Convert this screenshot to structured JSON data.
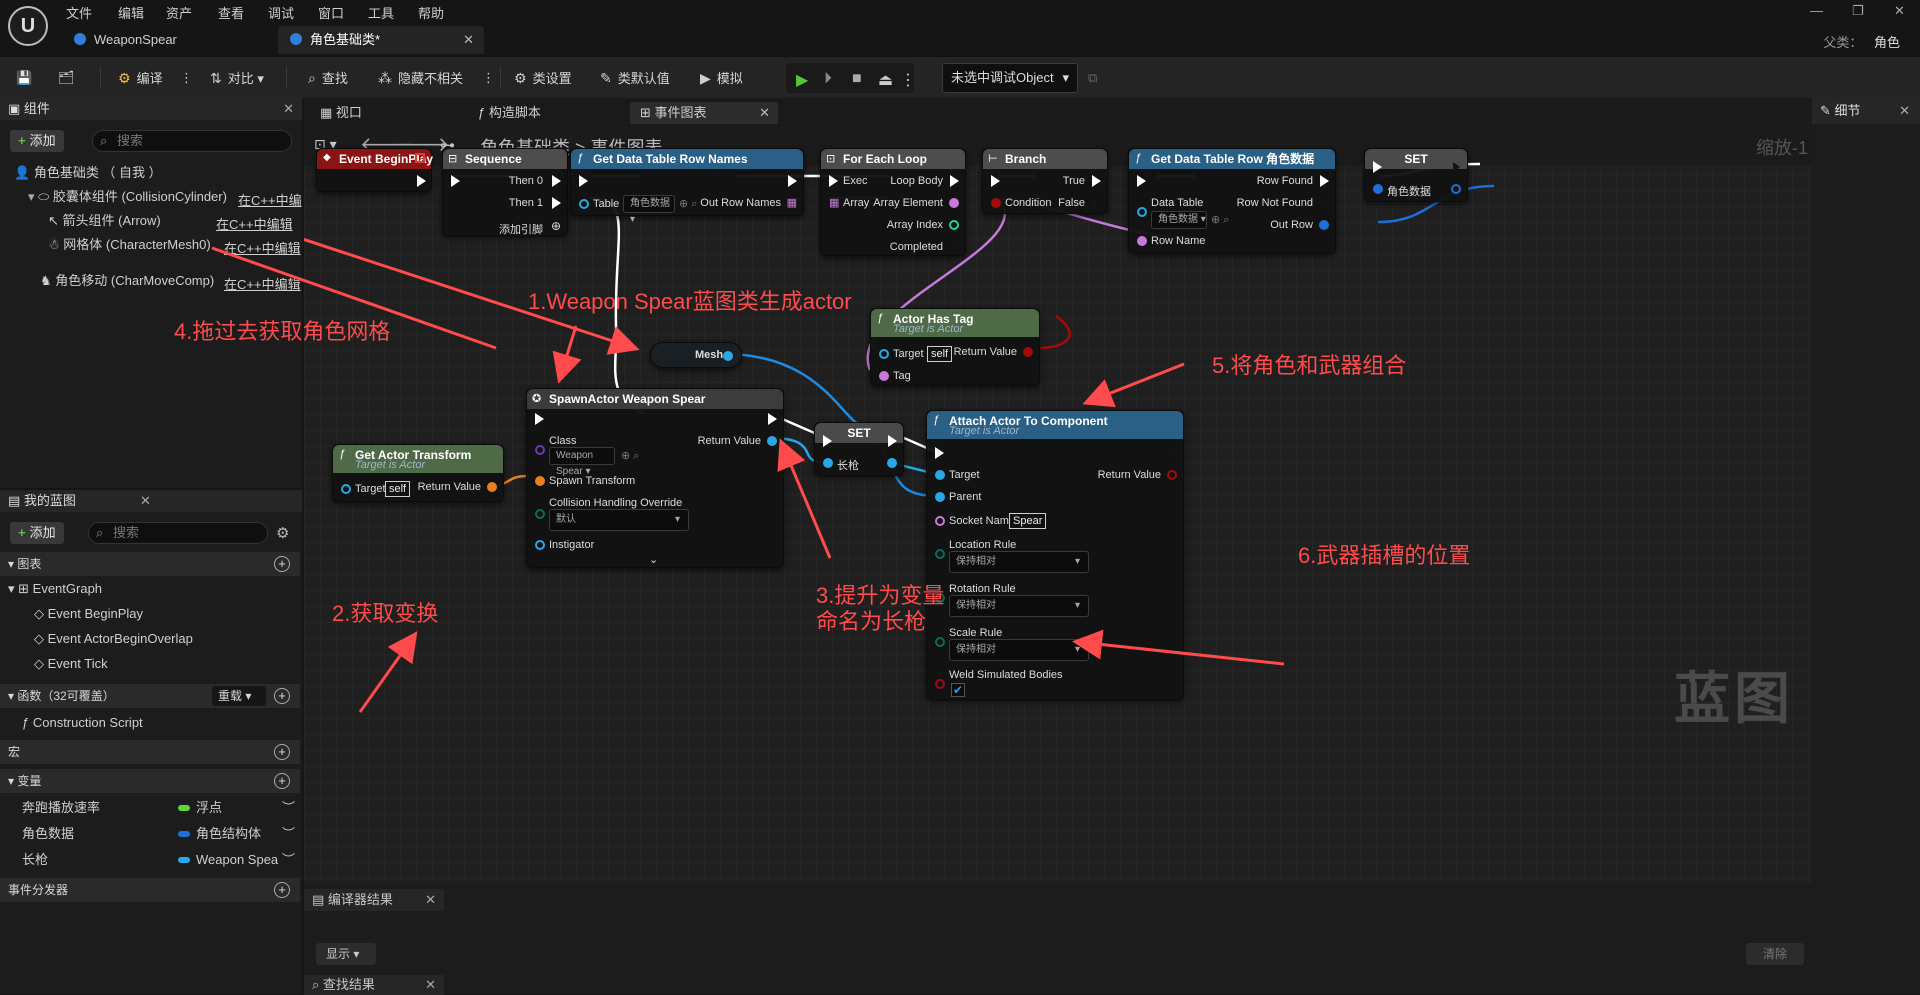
{
  "logo": "U",
  "menu": [
    "文件",
    "编辑",
    "资产",
    "查看",
    "调试",
    "窗口",
    "工具",
    "帮助"
  ],
  "doc_tabs": [
    {
      "label": "WeaponSpear"
    },
    {
      "label": "角色基础类*"
    }
  ],
  "parent": {
    "label": "父类：",
    "value": "角色"
  },
  "toolbar": {
    "compile": "编译",
    "diff": "对比",
    "find": "查找",
    "hide_unrelated": "隐藏不相关",
    "class_settings": "类设置",
    "class_defaults": "类默认值",
    "simulate": "模拟",
    "debug_object": "未选中调试Object"
  },
  "components_panel": {
    "title": "组件",
    "add": "添加",
    "search_placeholder": "搜索",
    "root": "角色基础类 （ 自我 ）",
    "items": [
      {
        "label": "胶囊体组件 (CollisionCylinder)",
        "edit": "在C++中编"
      },
      {
        "label": "箭头组件 (Arrow)",
        "edit": "在C++中编辑"
      },
      {
        "label": "网格体 (CharacterMesh0)",
        "edit": "在C++中编辑"
      },
      {
        "label": "角色移动 (CharMoveComp)",
        "edit": "在C++中编辑"
      }
    ]
  },
  "my_blueprint": {
    "title": "我的蓝图",
    "add": "添加",
    "search_placeholder": "搜索",
    "graphs_section": "图表",
    "event_graph": "EventGraph",
    "events": [
      "Event BeginPlay",
      "Event ActorBeginOverlap",
      "Event Tick"
    ],
    "functions_section": "函数（32可覆盖）",
    "override": "重载",
    "construction_script": "Construction Script",
    "macros_section": "宏",
    "variables_section": "变量",
    "variables": [
      {
        "name": "奔跑播放速率",
        "type": "浮点",
        "color": "#5fd43a"
      },
      {
        "name": "角色数据",
        "type": "角色结构体",
        "color": "#1f6fd8"
      },
      {
        "name": "长枪",
        "type": "Weapon Spea",
        "color": "#29a8e8"
      }
    ],
    "dispatchers_section": "事件分发器"
  },
  "graph_tabs": [
    "视口",
    "构造脚本",
    "事件图表"
  ],
  "breadcrumb": {
    "root": "角色基础类",
    "sep": ">",
    "current": "事件图表"
  },
  "zoom": "缩放-1",
  "watermark": "蓝图",
  "details_panel": {
    "title": "细节"
  },
  "bottom": {
    "compiler_results": "编译器结果",
    "show": "显示",
    "clear": "清除",
    "find_results": "查找结果"
  },
  "nodes": {
    "begin_play": {
      "title": "Event BeginPlay"
    },
    "sequence": {
      "title": "Sequence",
      "then0": "Then 0",
      "then1": "Then 1",
      "add_pin": "添加引脚"
    },
    "get_row_names": {
      "title": "Get Data Table Row Names",
      "table": "Table",
      "table_value": "角色数据",
      "out": "Out Row Names"
    },
    "for_each": {
      "title": "For Each Loop",
      "exec": "Exec",
      "loop_body": "Loop Body",
      "array": "Array",
      "array_element": "Array Element",
      "array_index": "Array Index",
      "completed": "Completed"
    },
    "branch": {
      "title": "Branch",
      "true": "True",
      "condition": "Condition",
      "false": "False"
    },
    "get_row": {
      "title": "Get Data Table Row 角色数据",
      "row_found": "Row Found",
      "data_table": "Data Table",
      "data_table_value": "角色数据",
      "row_not_found": "Row Not Found",
      "out_row": "Out Row",
      "row_name": "Row Name"
    },
    "set_top": {
      "title": "SET",
      "var": "角色数据"
    },
    "has_tag": {
      "title": "Actor Has Tag",
      "sub": "Target is Actor",
      "target": "Target",
      "self": "self",
      "return": "Return Value",
      "tag": "Tag"
    },
    "mesh": {
      "label": "Mesh"
    },
    "spawn": {
      "title": "SpawnActor Weapon Spear",
      "class": "Class",
      "class_value": "Weapon Spear",
      "return": "Return Value",
      "spawn_transform": "Spawn Transform",
      "collision": "Collision Handling Override",
      "collision_value": "默认",
      "instigator": "Instigator"
    },
    "get_transform": {
      "title": "Get Actor Transform",
      "sub": "Target is Actor",
      "target": "Target",
      "self": "self",
      "return": "Return Value"
    },
    "set_mid": {
      "title": "SET",
      "var": "长枪"
    },
    "attach": {
      "title": "Attach Actor To Component",
      "sub": "Target is Actor",
      "target": "Target",
      "return": "Return Value",
      "parent": "Parent",
      "socket": "Socket Name",
      "socket_value": "Spear",
      "location_rule": "Location Rule",
      "rotation_rule": "Rotation Rule",
      "scale_rule": "Scale Rule",
      "rule_value": "保持相对",
      "weld": "Weld Simulated Bodies"
    }
  },
  "annotations": {
    "a1": "1.Weapon Spear蓝图类生成actor",
    "a2": "2.获取变换",
    "a3_line1": "3.提升为变量",
    "a3_line2": "命名为长枪",
    "a4": "4.拖过去获取角色网格",
    "a5": "5.将角色和武器组合",
    "a6": "6.武器插槽的位置"
  },
  "colors": {
    "exec": "#ffffff",
    "struct": "#1f6fd8",
    "object": "#29a8e8",
    "name": "#c87adc",
    "bool": "#a40b0b",
    "int": "#1fd3a0",
    "annotation": "#ff4b4b"
  }
}
